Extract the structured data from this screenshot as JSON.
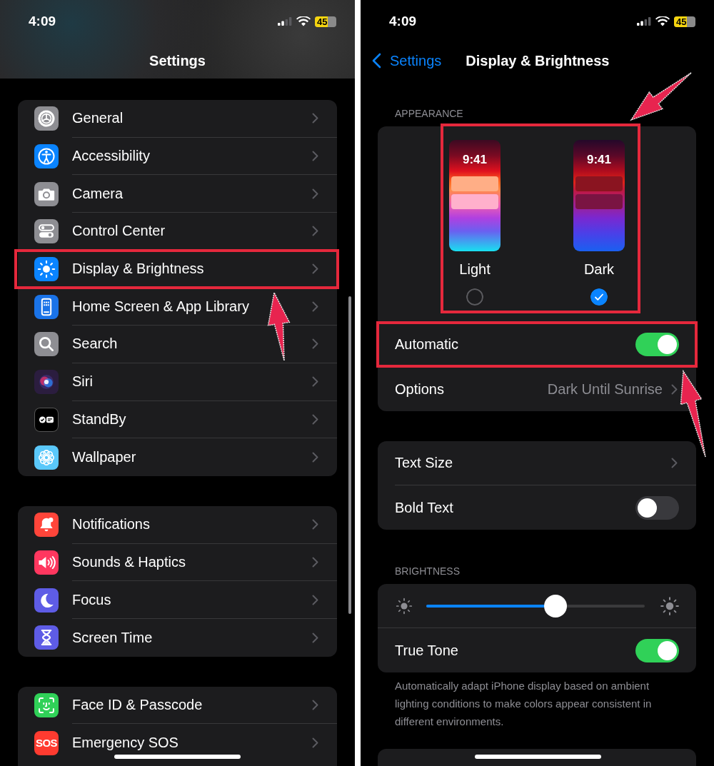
{
  "screens": [
    {
      "kind": "settings_list",
      "status_bar": {
        "time": "4:09",
        "battery": "45"
      },
      "title": "Settings",
      "groups": [
        {
          "items": [
            {
              "label": "General",
              "color": "#8e8e93",
              "highlighted": false
            },
            {
              "label": "Accessibility",
              "color": "#0a84ff",
              "highlighted": false
            },
            {
              "label": "Camera",
              "color": "#8e8e93",
              "highlighted": false
            },
            {
              "label": "Control Center",
              "color": "#8e8e93",
              "highlighted": false
            },
            {
              "label": "Display & Brightness",
              "color": "#0a84ff",
              "highlighted": true
            },
            {
              "label": "Home Screen & App Library",
              "color": "#1a73e8",
              "highlighted": false
            },
            {
              "label": "Search",
              "color": "#8e8e93",
              "highlighted": false
            },
            {
              "label": "Siri",
              "color": "#2b1d3f",
              "highlighted": false
            },
            {
              "label": "StandBy",
              "color": "#000000",
              "highlighted": false
            },
            {
              "label": "Wallpaper",
              "color": "#5ac8fa",
              "highlighted": false
            }
          ]
        },
        {
          "items": [
            {
              "label": "Notifications",
              "color": "#ff453a",
              "highlighted": false
            },
            {
              "label": "Sounds & Haptics",
              "color": "#ff375f",
              "highlighted": false
            },
            {
              "label": "Focus",
              "color": "#5e5ce6",
              "highlighted": false
            },
            {
              "label": "Screen Time",
              "color": "#5e5ce6",
              "highlighted": false
            }
          ]
        },
        {
          "items": [
            {
              "label": "Face ID & Passcode",
              "color": "#30d158",
              "highlighted": false
            },
            {
              "label": "Emergency SOS",
              "color": "#ff3b30",
              "icon_text": "SOS",
              "highlighted": false
            }
          ]
        }
      ]
    },
    {
      "kind": "display_settings",
      "status_bar": {
        "time": "4:09",
        "battery": "45"
      },
      "back_label": "Settings",
      "title": "Display & Brightness",
      "sections": [
        {
          "kind": "appearance",
          "header": "APPEARANCE",
          "highlighted": true,
          "options": [
            {
              "label": "Light",
              "preview_time": "9:41",
              "selected": false
            },
            {
              "label": "Dark",
              "preview_time": "9:41",
              "selected": true
            }
          ],
          "rows": [
            {
              "kind": "toggle",
              "label": "Automatic",
              "on": true,
              "highlighted": true
            },
            {
              "kind": "link",
              "label": "Options",
              "value": "Dark Until Sunrise",
              "highlighted": false
            }
          ]
        },
        {
          "kind": "list",
          "rows": [
            {
              "kind": "link",
              "label": "Text Size",
              "highlighted": false
            },
            {
              "kind": "toggle",
              "label": "Bold Text",
              "on": false,
              "highlighted": false
            }
          ]
        },
        {
          "kind": "brightness",
          "header": "BRIGHTNESS",
          "slider": {
            "level": 0.59
          },
          "rows": [
            {
              "kind": "toggle",
              "label": "True Tone",
              "on": true,
              "highlighted": false
            }
          ],
          "footer": "Automatically adapt iPhone display based on ambient lighting conditions to make colors appear consistent in different environments."
        },
        {
          "kind": "cut_off"
        }
      ]
    }
  ]
}
